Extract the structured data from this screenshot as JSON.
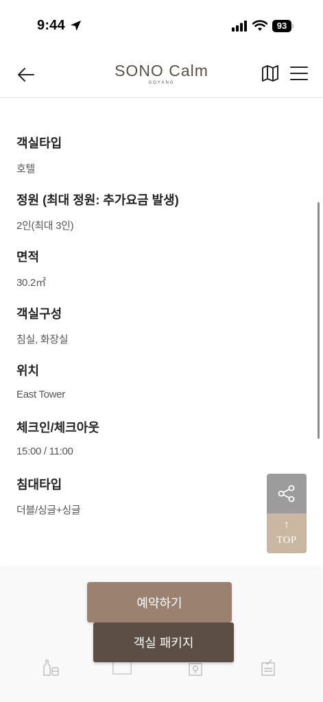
{
  "status_bar": {
    "time": "9:44",
    "battery": "93",
    "icons": [
      "location-arrow-icon",
      "signal-icon",
      "wifi-icon",
      "battery-icon"
    ]
  },
  "header": {
    "logo_main": "SONO Calm",
    "logo_sub": "GOYANG",
    "icons": [
      "back-arrow-icon",
      "map-icon",
      "menu-icon"
    ]
  },
  "room_info": [
    {
      "label": "객실타입",
      "value": "호텔"
    },
    {
      "label": "정원 (최대 정원: 추가요금 발생)",
      "value": "2인(최대 3인)"
    },
    {
      "label": "면적",
      "value": "30.2㎡"
    },
    {
      "label": "객실구성",
      "value": "침실, 화장실"
    },
    {
      "label": "위치",
      "value": "East Tower"
    },
    {
      "label": "체크인/체크아웃",
      "value": "15:00 / 11:00"
    },
    {
      "label": "침대타입",
      "value": "더블/싱글+싱글"
    }
  ],
  "floating": {
    "share_icon": "share-icon",
    "top_arrow": "↑",
    "top_label": "TOP"
  },
  "bottom": {
    "reserve_label": "예약하기",
    "package_label": "객실 패키지",
    "tab_icons": [
      "bottle-icon",
      "square-icon",
      "location-pin-icon",
      "checklist-icon"
    ]
  },
  "colors": {
    "reserve_button": "#9a8170",
    "package_button": "#5c4e45",
    "top_button": "#c9b7a1",
    "share_button": "#9c9c9c",
    "logo": "#5b5048"
  }
}
